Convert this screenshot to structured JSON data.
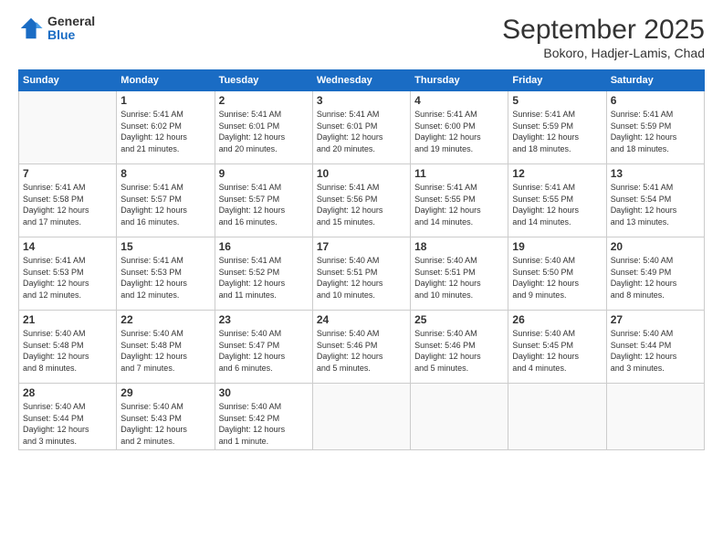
{
  "header": {
    "logo_general": "General",
    "logo_blue": "Blue",
    "month": "September 2025",
    "location": "Bokoro, Hadjer-Lamis, Chad"
  },
  "days_of_week": [
    "Sunday",
    "Monday",
    "Tuesday",
    "Wednesday",
    "Thursday",
    "Friday",
    "Saturday"
  ],
  "weeks": [
    [
      {
        "day": "",
        "info": ""
      },
      {
        "day": "1",
        "info": "Sunrise: 5:41 AM\nSunset: 6:02 PM\nDaylight: 12 hours\nand 21 minutes."
      },
      {
        "day": "2",
        "info": "Sunrise: 5:41 AM\nSunset: 6:01 PM\nDaylight: 12 hours\nand 20 minutes."
      },
      {
        "day": "3",
        "info": "Sunrise: 5:41 AM\nSunset: 6:01 PM\nDaylight: 12 hours\nand 20 minutes."
      },
      {
        "day": "4",
        "info": "Sunrise: 5:41 AM\nSunset: 6:00 PM\nDaylight: 12 hours\nand 19 minutes."
      },
      {
        "day": "5",
        "info": "Sunrise: 5:41 AM\nSunset: 5:59 PM\nDaylight: 12 hours\nand 18 minutes."
      },
      {
        "day": "6",
        "info": "Sunrise: 5:41 AM\nSunset: 5:59 PM\nDaylight: 12 hours\nand 18 minutes."
      }
    ],
    [
      {
        "day": "7",
        "info": "Sunrise: 5:41 AM\nSunset: 5:58 PM\nDaylight: 12 hours\nand 17 minutes."
      },
      {
        "day": "8",
        "info": "Sunrise: 5:41 AM\nSunset: 5:57 PM\nDaylight: 12 hours\nand 16 minutes."
      },
      {
        "day": "9",
        "info": "Sunrise: 5:41 AM\nSunset: 5:57 PM\nDaylight: 12 hours\nand 16 minutes."
      },
      {
        "day": "10",
        "info": "Sunrise: 5:41 AM\nSunset: 5:56 PM\nDaylight: 12 hours\nand 15 minutes."
      },
      {
        "day": "11",
        "info": "Sunrise: 5:41 AM\nSunset: 5:55 PM\nDaylight: 12 hours\nand 14 minutes."
      },
      {
        "day": "12",
        "info": "Sunrise: 5:41 AM\nSunset: 5:55 PM\nDaylight: 12 hours\nand 14 minutes."
      },
      {
        "day": "13",
        "info": "Sunrise: 5:41 AM\nSunset: 5:54 PM\nDaylight: 12 hours\nand 13 minutes."
      }
    ],
    [
      {
        "day": "14",
        "info": "Sunrise: 5:41 AM\nSunset: 5:53 PM\nDaylight: 12 hours\nand 12 minutes."
      },
      {
        "day": "15",
        "info": "Sunrise: 5:41 AM\nSunset: 5:53 PM\nDaylight: 12 hours\nand 12 minutes."
      },
      {
        "day": "16",
        "info": "Sunrise: 5:41 AM\nSunset: 5:52 PM\nDaylight: 12 hours\nand 11 minutes."
      },
      {
        "day": "17",
        "info": "Sunrise: 5:40 AM\nSunset: 5:51 PM\nDaylight: 12 hours\nand 10 minutes."
      },
      {
        "day": "18",
        "info": "Sunrise: 5:40 AM\nSunset: 5:51 PM\nDaylight: 12 hours\nand 10 minutes."
      },
      {
        "day": "19",
        "info": "Sunrise: 5:40 AM\nSunset: 5:50 PM\nDaylight: 12 hours\nand 9 minutes."
      },
      {
        "day": "20",
        "info": "Sunrise: 5:40 AM\nSunset: 5:49 PM\nDaylight: 12 hours\nand 8 minutes."
      }
    ],
    [
      {
        "day": "21",
        "info": "Sunrise: 5:40 AM\nSunset: 5:48 PM\nDaylight: 12 hours\nand 8 minutes."
      },
      {
        "day": "22",
        "info": "Sunrise: 5:40 AM\nSunset: 5:48 PM\nDaylight: 12 hours\nand 7 minutes."
      },
      {
        "day": "23",
        "info": "Sunrise: 5:40 AM\nSunset: 5:47 PM\nDaylight: 12 hours\nand 6 minutes."
      },
      {
        "day": "24",
        "info": "Sunrise: 5:40 AM\nSunset: 5:46 PM\nDaylight: 12 hours\nand 5 minutes."
      },
      {
        "day": "25",
        "info": "Sunrise: 5:40 AM\nSunset: 5:46 PM\nDaylight: 12 hours\nand 5 minutes."
      },
      {
        "day": "26",
        "info": "Sunrise: 5:40 AM\nSunset: 5:45 PM\nDaylight: 12 hours\nand 4 minutes."
      },
      {
        "day": "27",
        "info": "Sunrise: 5:40 AM\nSunset: 5:44 PM\nDaylight: 12 hours\nand 3 minutes."
      }
    ],
    [
      {
        "day": "28",
        "info": "Sunrise: 5:40 AM\nSunset: 5:44 PM\nDaylight: 12 hours\nand 3 minutes."
      },
      {
        "day": "29",
        "info": "Sunrise: 5:40 AM\nSunset: 5:43 PM\nDaylight: 12 hours\nand 2 minutes."
      },
      {
        "day": "30",
        "info": "Sunrise: 5:40 AM\nSunset: 5:42 PM\nDaylight: 12 hours\nand 1 minute."
      },
      {
        "day": "",
        "info": ""
      },
      {
        "day": "",
        "info": ""
      },
      {
        "day": "",
        "info": ""
      },
      {
        "day": "",
        "info": ""
      }
    ]
  ]
}
